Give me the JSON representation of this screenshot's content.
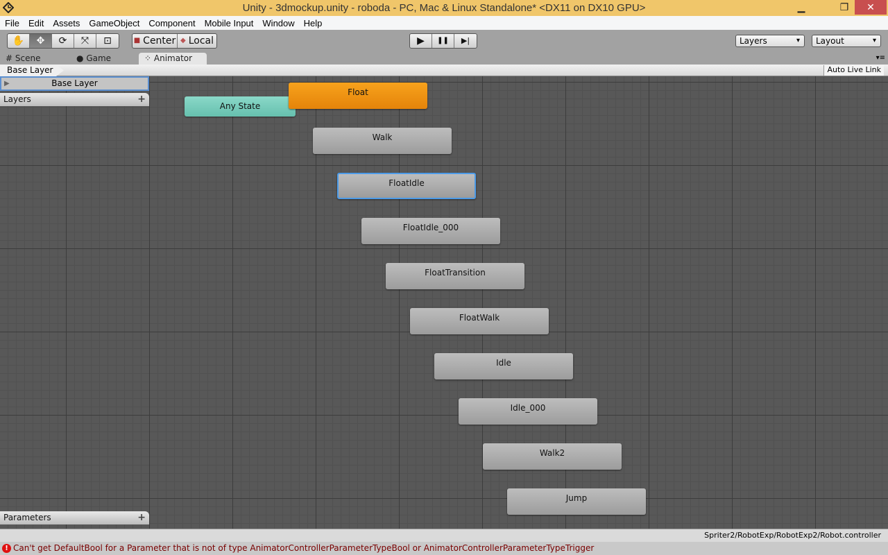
{
  "window": {
    "title": "Unity - 3dmockup.unity - roboda - PC, Mac & Linux Standalone* <DX11 on DX10 GPU>",
    "minimize": "▁",
    "maximize": "❐",
    "close": "✕"
  },
  "menu": [
    "File",
    "Edit",
    "Assets",
    "GameObject",
    "Component",
    "Mobile Input",
    "Window",
    "Help"
  ],
  "toolbar": {
    "tools": [
      "✋",
      "✥",
      "⟳",
      "⤧",
      "⊡"
    ],
    "pivot": "Center",
    "space": "Local",
    "play": "▶",
    "pause": "❚❚",
    "step": "▶|",
    "layers": "Layers",
    "layout": "Layout"
  },
  "tabs": [
    {
      "label": "Scene",
      "icon": "#"
    },
    {
      "label": "Game",
      "icon": "●"
    },
    {
      "label": "Animator",
      "icon": "⁘"
    }
  ],
  "breadcrumb": "Base Layer",
  "auto_live_link": "Auto Live Link",
  "left_panel": {
    "layer": "Base Layer",
    "layers_title": "Layers",
    "parameters_title": "Parameters",
    "plus": "+"
  },
  "states": {
    "any": "Any State",
    "default": "Float",
    "list": [
      "Walk",
      "FloatIdle",
      "FloatIdle_000",
      "FloatTransition",
      "FloatWalk",
      "Idle",
      "Idle_000",
      "Walk2",
      "Jump"
    ],
    "selected": "FloatIdle"
  },
  "path": "Spriter2/RobotExp/RobotExp2/Robot.controller",
  "status": {
    "icon": "!",
    "message": "Can't get DefaultBool for a Parameter that is not of type AnimatorControllerParameterTypeBool or AnimatorControllerParameterTypeTrigger"
  }
}
